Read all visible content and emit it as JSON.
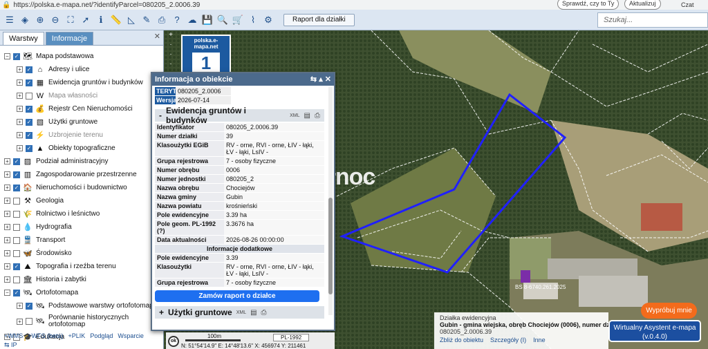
{
  "browser": {
    "url": "https://polska.e-mapa.net/?identifyParcel=080205_2.0006.39",
    "search_chip": "Sprawdź, czy to Ty",
    "update_chip": "Aktualizuj",
    "copilot": "Czat"
  },
  "toolbar": {
    "raport_label": "Raport dla działki",
    "search_placeholder": "Szukaj..."
  },
  "left": {
    "tabs": [
      "Warstwy",
      "Informacje"
    ],
    "layers": [
      {
        "label": "Mapa podstawowa",
        "pm": "−",
        "checked": true,
        "icon": "map-icon",
        "indent": 0
      },
      {
        "label": "Adresy i ulice",
        "pm": "+",
        "checked": true,
        "icon": "address-icon",
        "indent": 1
      },
      {
        "label": "Ewidencja gruntów i budynków",
        "pm": "+",
        "checked": true,
        "icon": "parcel-icon",
        "indent": 1
      },
      {
        "label": "Mapa własności",
        "pm": "+",
        "checked": false,
        "icon": "ownership-icon",
        "indent": 1,
        "dim": true
      },
      {
        "label": "Rejestr Cen Nieruchomości",
        "pm": "+",
        "checked": true,
        "icon": "price-icon",
        "indent": 1
      },
      {
        "label": "Użytki gruntowe",
        "pm": "+",
        "checked": true,
        "icon": "landuse-icon",
        "indent": 1
      },
      {
        "label": "Uzbrojenie terenu",
        "pm": "+",
        "checked": true,
        "icon": "utilities-icon",
        "indent": 1,
        "dim": true
      },
      {
        "label": "Obiekty topograficzne",
        "pm": "+",
        "checked": true,
        "icon": "topo-icon",
        "indent": 1
      },
      {
        "label": "Podział administracyjny",
        "pm": "+",
        "checked": true,
        "icon": "admin-icon",
        "indent": 0
      },
      {
        "label": "Zagospodarowanie przestrzenne",
        "pm": "+",
        "checked": true,
        "icon": "planning-icon",
        "indent": 0
      },
      {
        "label": "Nieruchomości i budownictwo",
        "pm": "+",
        "checked": true,
        "icon": "building-icon",
        "indent": 0
      },
      {
        "label": "Geologia",
        "pm": "+",
        "checked": false,
        "icon": "geology-icon",
        "indent": 0
      },
      {
        "label": "Rolnictwo i leśnictwo",
        "pm": "+",
        "checked": false,
        "icon": "agriculture-icon",
        "indent": 0
      },
      {
        "label": "Hydrografia",
        "pm": "+",
        "checked": false,
        "icon": "water-icon",
        "indent": 0
      },
      {
        "label": "Transport",
        "pm": "+",
        "checked": false,
        "icon": "transport-icon",
        "indent": 0
      },
      {
        "label": "Środowisko",
        "pm": "+",
        "checked": false,
        "icon": "environment-icon",
        "indent": 0
      },
      {
        "label": "Topografia i rzeźba terenu",
        "pm": "+",
        "checked": true,
        "icon": "terrain-icon",
        "indent": 0
      },
      {
        "label": "Historia i zabytki",
        "pm": "+",
        "checked": false,
        "icon": "history-icon",
        "indent": 0
      },
      {
        "label": "Ortofotomapa",
        "pm": "−",
        "checked": true,
        "icon": "satellite-icon",
        "indent": 0
      },
      {
        "label": "Podstawowe warstwy ortofotomapy",
        "pm": "+",
        "checked": true,
        "icon": "satellite-icon",
        "indent": 1
      },
      {
        "label": "Porównanie historycznych ortofotomap",
        "pm": "+",
        "checked": false,
        "icon": "satellite-icon",
        "indent": 1,
        "tall": true
      },
      {
        "label": "Edukacja",
        "pm": "+",
        "checked": false,
        "icon": "education-icon",
        "indent": 0
      }
    ],
    "links": [
      "+WMS",
      "+WFS (beta)",
      "+PLIK",
      "Podgląd",
      "Wsparcie"
    ],
    "links2": "⇆ IP"
  },
  "logo": {
    "label": "polska.e-mapa.net",
    "number": "1"
  },
  "dialog": {
    "title": "Informacja o obiekcie",
    "teryt": [
      {
        "k": "TERYT",
        "v": "080205_2.0006"
      },
      {
        "k": "Wersja",
        "v": "2026-07-14"
      }
    ],
    "section1": "Ewidencja gruntów i budynków",
    "xml": "XML",
    "rows": [
      {
        "k": "Identyfikator",
        "v": "080205_2.0006.39"
      },
      {
        "k": "Numer działki",
        "v": "39"
      },
      {
        "k": "Klasoużytki EGiB",
        "v": "RV - orne, RVI - orne, ŁIV - łąki, ŁV - łąki, LsIV -"
      },
      {
        "k": "Grupa rejestrowa",
        "v": "7 - osoby fizyczne"
      },
      {
        "k": "Numer obrębu",
        "v": "0006"
      },
      {
        "k": "Numer jednostki",
        "v": "080205_2"
      },
      {
        "k": "Nazwa obrębu",
        "v": "Chociejów"
      },
      {
        "k": "Nazwa gminy",
        "v": "Gubin"
      },
      {
        "k": "Nazwa powiatu",
        "v": "krośnieński"
      },
      {
        "k": "Pole ewidencyjne",
        "v": "3.39 ha"
      },
      {
        "k": "Pole geom. PL-1992 (?)",
        "v": "3.3676 ha"
      },
      {
        "k": "Data aktualności",
        "v": "2026-08-26 00:00:00"
      }
    ],
    "extra_header": "Informacje dodatkowe",
    "extra": [
      {
        "k": "Pole ewidencyjne",
        "v": "3.39"
      },
      {
        "k": "Klasoużytki",
        "v": "RV - orne, RVI - orne, ŁIV - łąki, ŁV - łąki, LsIV -"
      },
      {
        "k": "Grupa rejestrowa",
        "v": "7 - osoby fizyczne"
      }
    ],
    "order_btn": "Zamów raport o działce",
    "section2": "Użytki gruntowe"
  },
  "scale": {
    "label": "100m",
    "crs": "PL-1992",
    "coords": "N: 51°54'14.9\"  E: 14°48'13.6\"  X: 456974   Y: 211461"
  },
  "bottom": {
    "head": "Działka ewidencyjna",
    "title": "Gubin - gmina wiejska, obręb Chociejów (0006), numer dz 39",
    "sub": "080205_2.0006.39",
    "links": [
      "Zbliż do obiektu",
      "Szczegóły (I)",
      "Inne"
    ]
  },
  "promo": {
    "orange": "Wypróbuj mnie",
    "assistant_line1": "Wirtualny Asystent e-mapa",
    "assistant_line2": "(v.0.4.0)"
  },
  "watermark": "Północ",
  "map_label": "BS 8-6740.261.2025"
}
